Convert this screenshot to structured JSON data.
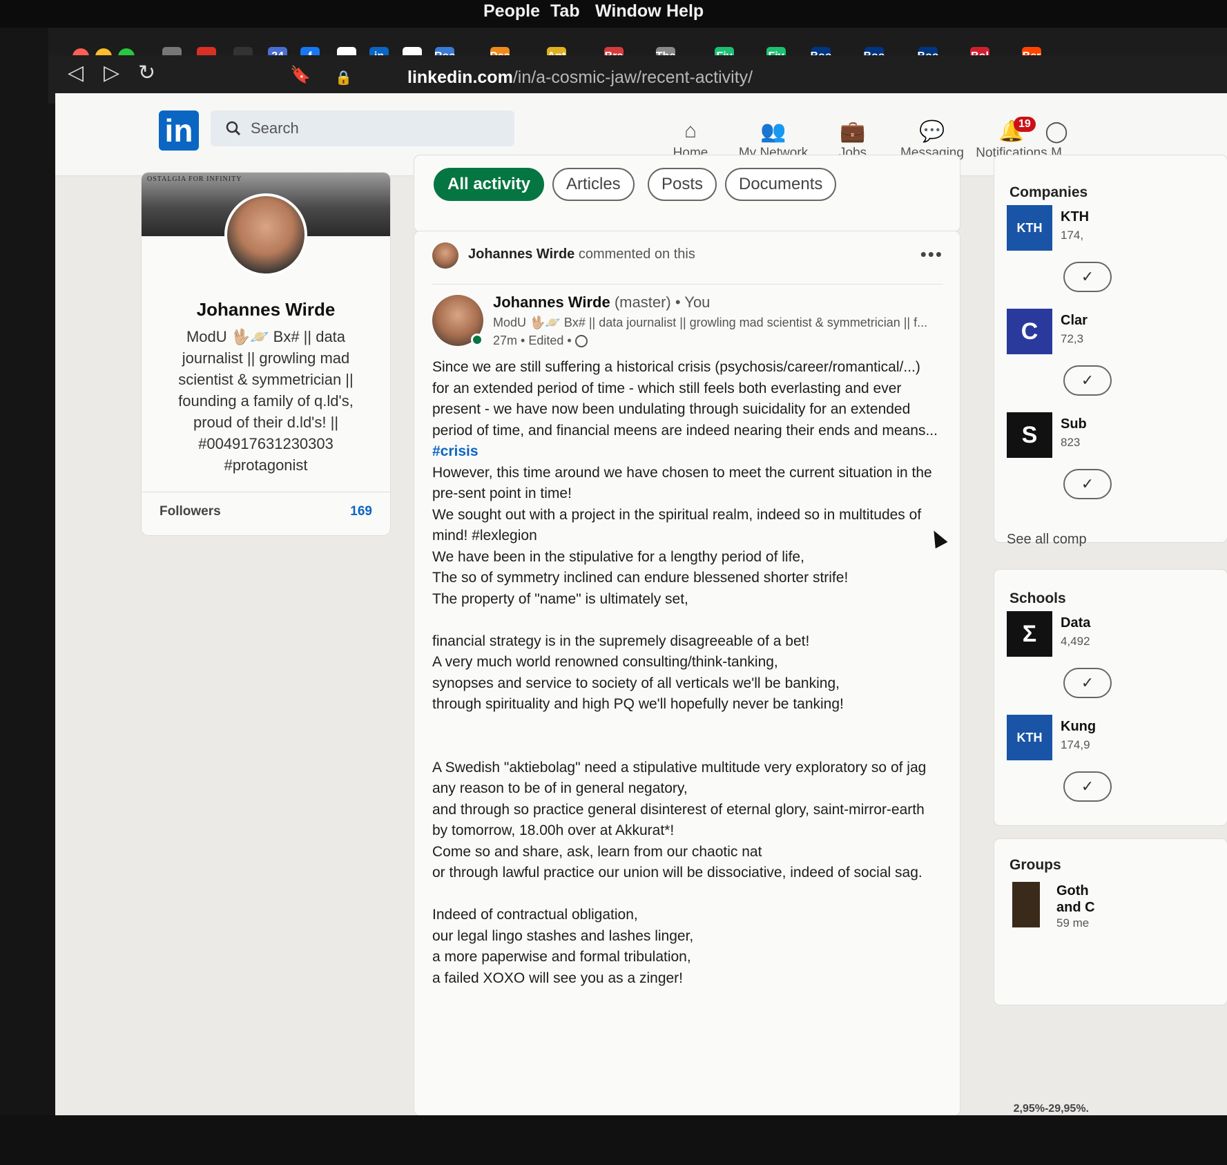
{
  "menubar": {
    "items": [
      "People",
      "Tab",
      "Window",
      "Help"
    ]
  },
  "bookmarks": [
    {
      "icon": "calendar-icon",
      "label": "",
      "color": "#777"
    },
    {
      "icon": "gmail-icon",
      "label": "",
      "color": "#d93025"
    },
    {
      "icon": "blank-icon",
      "label": "",
      "color": "#333"
    },
    {
      "icon": "calendar-24-icon",
      "label": "24",
      "color": "#4a6fd1"
    },
    {
      "icon": "facebook-icon",
      "label": "f",
      "color": "#1877f2"
    },
    {
      "icon": "github-icon",
      "label": "",
      "color": "#ffffff"
    },
    {
      "icon": "linkedin-icon",
      "label": "in",
      "color": "#0a66c2"
    },
    {
      "icon": "patreon-icon",
      "label": "",
      "color": "#ffffff"
    },
    {
      "icon": "roc-icon",
      "label": "Roc",
      "color": "#3a7bd5"
    },
    {
      "icon": "das-icon",
      "label": "Das",
      "color": "#f08a1c"
    },
    {
      "icon": "ant-icon",
      "label": "Ant",
      "color": "#e0b020"
    },
    {
      "icon": "bra-icon",
      "label": "Bra",
      "color": "#d43c3c"
    },
    {
      "icon": "the-icon",
      "label": "The",
      "color": "#888"
    },
    {
      "icon": "fiverr-icon",
      "label": "Fiv",
      "color": "#1dbf73"
    },
    {
      "icon": "fiverr-icon",
      "label": "Fiv",
      "color": "#1dbf73"
    },
    {
      "icon": "booking-icon",
      "label": "Boo",
      "color": "#003580"
    },
    {
      "icon": "booking-icon",
      "label": "Boo",
      "color": "#003580"
    },
    {
      "icon": "booking-icon",
      "label": "Boo",
      "color": "#003580"
    },
    {
      "icon": "s-icon",
      "label": "Bol",
      "color": "#d01f2f"
    },
    {
      "icon": "reddit-icon",
      "label": "Ber",
      "color": "#ff4500"
    }
  ],
  "browser": {
    "url_domain": "linkedin.com",
    "url_path": "/in/a-cosmic-jaw/recent-activity/"
  },
  "header": {
    "logo": "in",
    "search_placeholder": "Search",
    "nav": [
      {
        "icon": "home-icon",
        "label": "Home"
      },
      {
        "icon": "network-icon",
        "label": "My Network"
      },
      {
        "icon": "jobs-icon",
        "label": "Jobs"
      },
      {
        "icon": "messaging-icon",
        "label": "Messaging"
      },
      {
        "icon": "bell-icon",
        "label": "Notifications",
        "badge": "19"
      },
      {
        "icon": "me-icon",
        "label": "M"
      }
    ]
  },
  "profile": {
    "cover_text": "OSTALGIA FOR INFINITY",
    "name": "Johannes Wirde",
    "headline": "ModU 🖖🏼🪐 Bx# || data journalist || growling mad scientist & symmetrician || founding a family of q.ld's, proud of their d.ld's! || #004917631230303 #protagonist",
    "followers_label": "Followers",
    "followers_count": "169"
  },
  "filters": [
    "All activity",
    "Articles",
    "Posts",
    "Documents"
  ],
  "post": {
    "context_name": "Johannes Wirde",
    "context_action": "commented on this",
    "author_name": "Johannes Wirde",
    "author_suffix": "(master)",
    "author_you": "• You",
    "subhead": "ModU 🖖🏼🪐 Bx# || data journalist || growling mad scientist & symmetrician || f...",
    "meta": "27m • Edited •",
    "lines": [
      {
        "t": "Since we are still suffering a historical crisis (psychosis/career/romantical/...)"
      },
      {
        "t": "for an extended period of time - which still feels both everlasting and ever"
      },
      {
        "t": "present - we have now been undulating through suicidality for an extended"
      },
      {
        "t": "period of time, and financial meens are indeed nearing their ends and means..."
      },
      {
        "t": "#crisis",
        "tag": true
      },
      {
        "t": "However, this time around we have chosen to meet the current situation in the"
      },
      {
        "t": "pre-sent point in time!"
      },
      {
        "t": "We sought out with a project in the spiritual realm, indeed so in multitudes of"
      },
      {
        "t": "mind! #lexlegion"
      },
      {
        "t": "We have been in the stipulative for a lengthy period of life,"
      },
      {
        "t": "The so of symmetry inclined can endure blessened shorter strife!"
      },
      {
        "t": "The property of \"name\" is ultimately set,"
      },
      {
        "t": ""
      },
      {
        "t": "financial strategy is in the supremely disagreeable of a bet!"
      },
      {
        "t": "A very much world renowned consulting/think-tanking,"
      },
      {
        "t": "synopses and service to society of all verticals we'll be banking,"
      },
      {
        "t": "through spirituality and high PQ we'll hopefully never be tanking!"
      },
      {
        "t": ""
      },
      {
        "t": ""
      },
      {
        "t": "A Swedish \"aktiebolag\" need a stipulative multitude very exploratory so of jag"
      },
      {
        "t": "any reason to be of in general negatory,"
      },
      {
        "t": "and through so practice general disinterest of eternal glory, saint-mirror-earth"
      },
      {
        "t": "by tomorrow, 18.00h over at Akkurat*!"
      },
      {
        "t": "Come so and share, ask, learn from our chaotic nat"
      },
      {
        "t": "or through lawful practice our union will be dissociative, indeed of social sag."
      },
      {
        "t": ""
      },
      {
        "t": "Indeed of contractual obligation,"
      },
      {
        "t": "our legal lingo stashes and lashes linger,"
      },
      {
        "t": "a more paperwise and formal tribulation,"
      },
      {
        "t": "a failed XOXO will see you as a zinger!"
      }
    ]
  },
  "right": {
    "companies_title": "Companies",
    "companies": [
      {
        "name": "KTH",
        "sub": "174,",
        "logo": "KTH",
        "color": "#1954a6"
      },
      {
        "name": "Clar",
        "sub": "72,3",
        "logo": "C",
        "color": "#2a3a9c"
      },
      {
        "name": "Sub",
        "sub": "823",
        "logo": "S",
        "color": "#111111"
      }
    ],
    "see_all": "See all comp",
    "schools_title": "Schools",
    "schools": [
      {
        "name": "Data",
        "sub": "4,492",
        "logo": "Σ",
        "color": "#111111"
      },
      {
        "name": "Kung",
        "sub": "174,9",
        "logo": "KTH",
        "color": "#1954a6"
      }
    ],
    "groups_title": "Groups",
    "group": {
      "name1": "Goth",
      "name2": "and C",
      "sub": "59 me"
    },
    "check": "✓"
  },
  "status": {
    "zoom": "2,95%-29,95%."
  }
}
